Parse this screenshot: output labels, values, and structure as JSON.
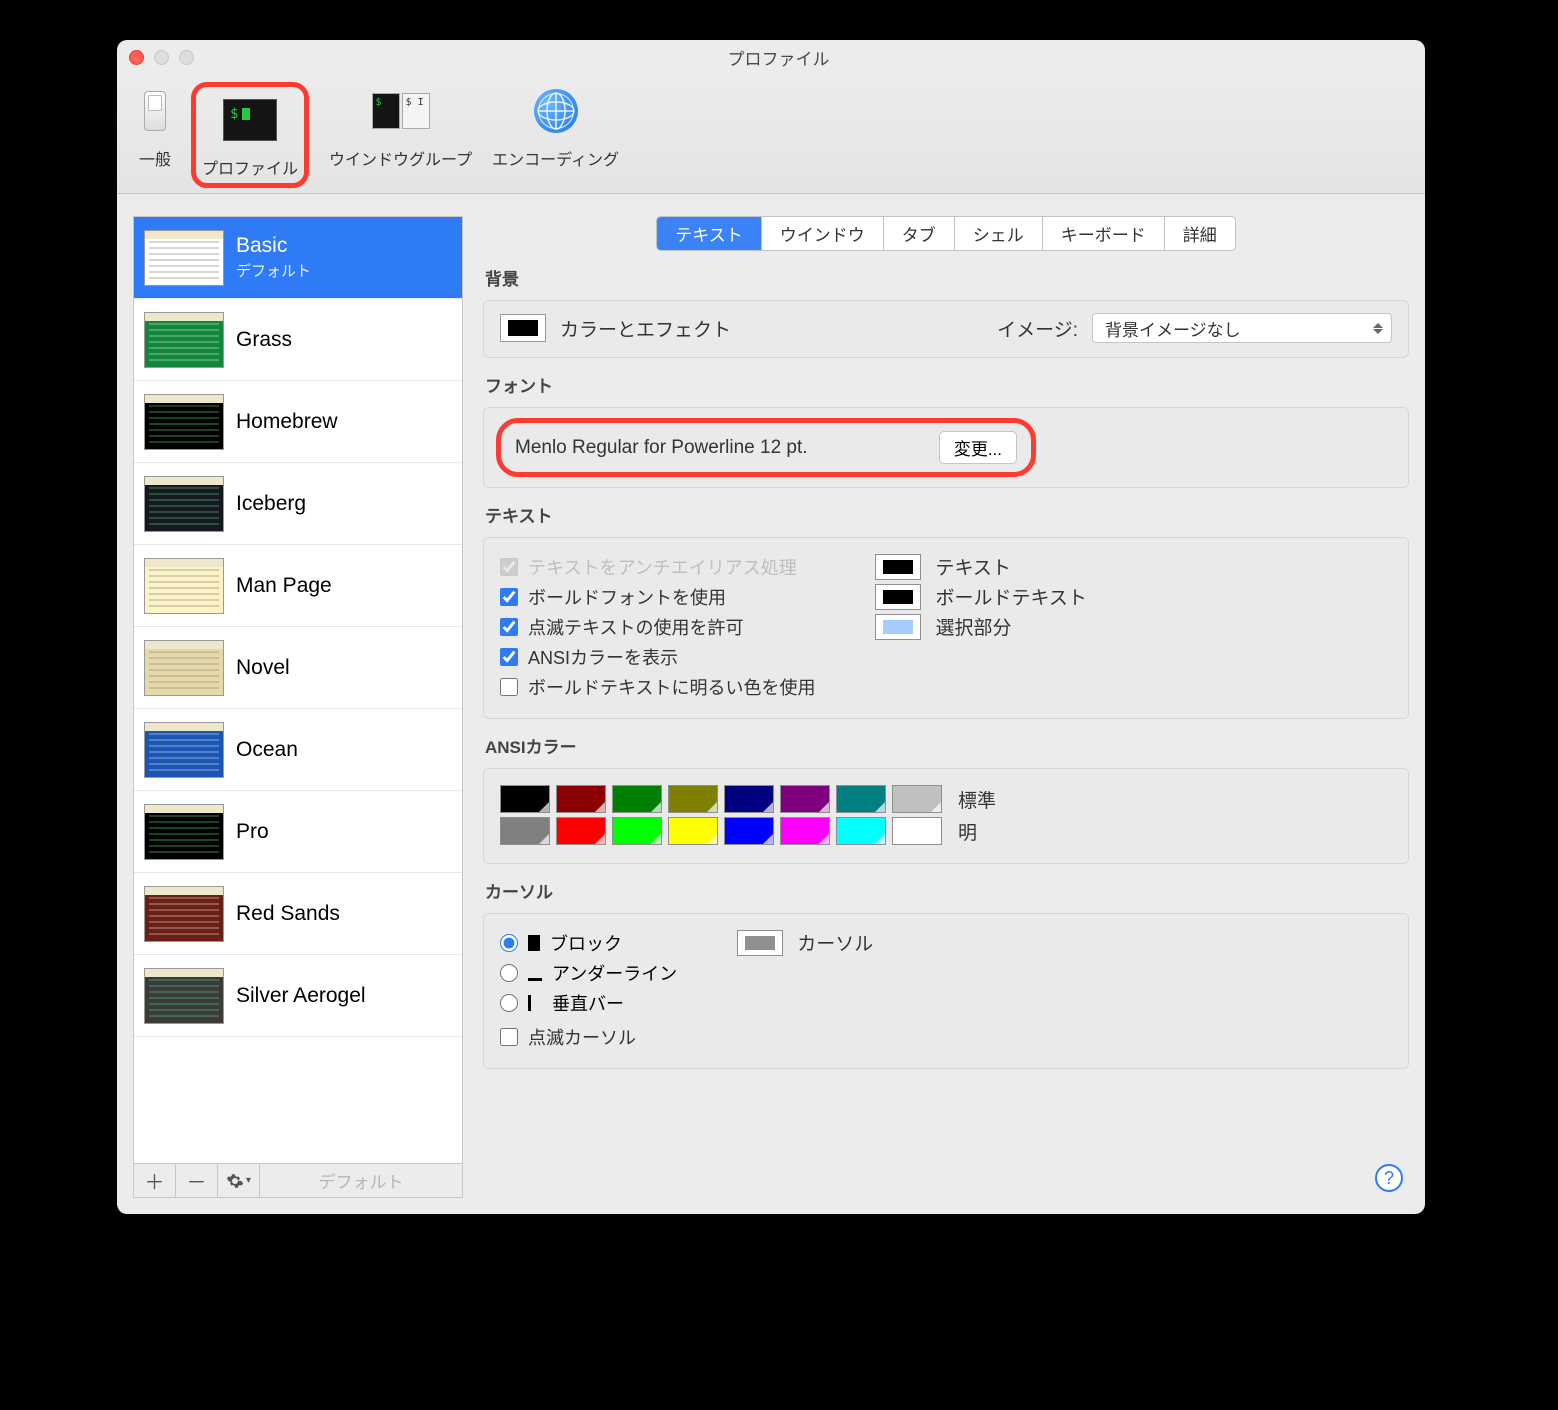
{
  "window": {
    "title": "プロファイル"
  },
  "toolbar": {
    "general": "一般",
    "profiles": "プロファイル",
    "window_groups": "ウインドウグループ",
    "encodings": "エンコーディング"
  },
  "sidebar": {
    "profiles": [
      {
        "name": "Basic",
        "sub": "デフォルト",
        "cls": "th-basic",
        "selected": true
      },
      {
        "name": "Grass",
        "cls": "th-grass"
      },
      {
        "name": "Homebrew",
        "cls": "th-home"
      },
      {
        "name": "Iceberg",
        "cls": "th-ice"
      },
      {
        "name": "Man Page",
        "cls": "th-man"
      },
      {
        "name": "Novel",
        "cls": "th-novel"
      },
      {
        "name": "Ocean",
        "cls": "th-ocean"
      },
      {
        "name": "Pro",
        "cls": "th-pro"
      },
      {
        "name": "Red Sands",
        "cls": "th-red"
      },
      {
        "name": "Silver Aerogel",
        "cls": "th-silver"
      }
    ],
    "default_btn": "デフォルト"
  },
  "tabs": {
    "items": [
      "テキスト",
      "ウインドウ",
      "タブ",
      "シェル",
      "キーボード",
      "詳細"
    ],
    "selected": 0
  },
  "background": {
    "heading": "背景",
    "color_label": "カラーとエフェクト",
    "image_label": "イメージ:",
    "image_select": "背景イメージなし"
  },
  "font": {
    "heading": "フォント",
    "value": "Menlo Regular for Powerline 12 pt.",
    "change_btn": "変更..."
  },
  "text": {
    "heading": "テキスト",
    "antialias": "テキストをアンチエイリアス処理",
    "bold_fonts": "ボールドフォントを使用",
    "allow_blink": "点滅テキストの使用を許可",
    "ansi_colors": "ANSIカラーを表示",
    "bright_bold": "ボールドテキストに明るい色を使用",
    "text_label": "テキスト",
    "bold_label": "ボールドテキスト",
    "selection_label": "選択部分",
    "text_color": "#000000",
    "bold_color": "#000000",
    "selection_color": "#a4cdfe"
  },
  "ansi": {
    "heading": "ANSIカラー",
    "normal_label": "標準",
    "bright_label": "明",
    "normal": [
      "#000000",
      "#8b0000",
      "#008000",
      "#808000",
      "#000080",
      "#800080",
      "#008080",
      "#c0c0c0"
    ],
    "bright": [
      "#808080",
      "#ff0000",
      "#00ff00",
      "#ffff00",
      "#0000ff",
      "#ff00ff",
      "#00ffff",
      "#ffffff"
    ]
  },
  "cursor": {
    "heading": "カーソル",
    "block": "ブロック",
    "underline": "アンダーライン",
    "vbar": "垂直バー",
    "blink": "点滅カーソル",
    "cursor_label": "カーソル",
    "cursor_color": "#8f8f8f"
  }
}
